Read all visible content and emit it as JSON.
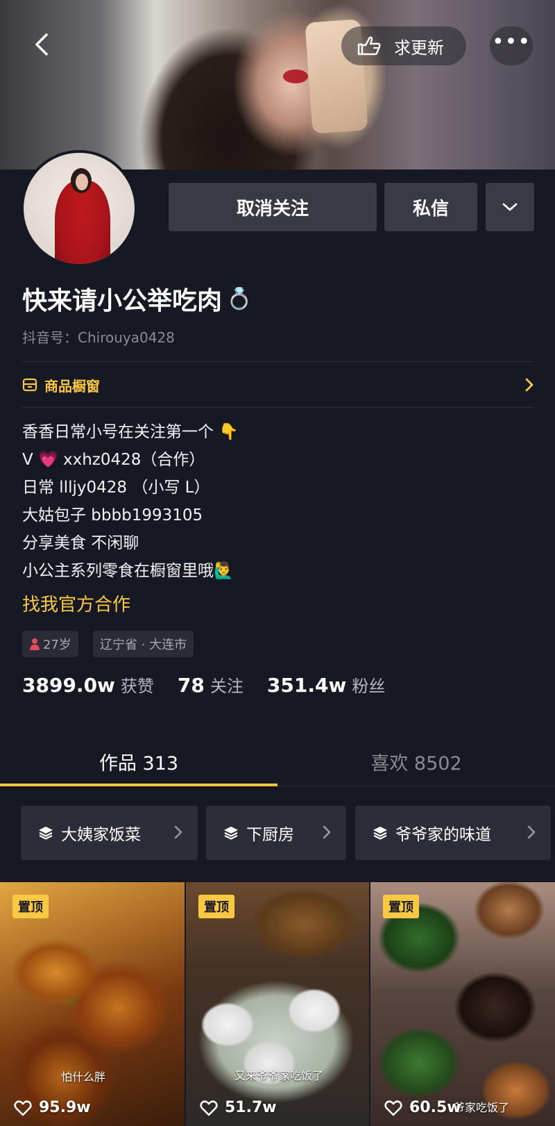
{
  "header": {
    "request_update_label": "求更新",
    "more_label": "•••"
  },
  "actions": {
    "unfollow_label": "取消关注",
    "message_label": "私信"
  },
  "profile": {
    "nickname": "快来请小公举吃肉",
    "nickname_emoji": "💍",
    "douyin_id": "抖音号：Chirouya0428",
    "shop_label": "商品橱窗",
    "bio": [
      "香香日常小号在关注第一个 👇",
      "V 💗 xxhz0428（合作）",
      "日常 llljy0428 （小写 L）",
      "大姑包子 bbbb1993105",
      "分享美食 不闲聊",
      "小公主系列零食在橱窗里哦🙋‍♂️"
    ],
    "cooperate_link": "找我官方合作",
    "tags": {
      "age": "27岁",
      "location": "辽宁省 · 大连市"
    },
    "stats": {
      "likes_num": "3899.0w",
      "likes_label": "获赞",
      "following_num": "78",
      "following_label": "关注",
      "followers_num": "351.4w",
      "followers_label": "粉丝"
    }
  },
  "tabs": {
    "works": "作品 313",
    "likes": "喜欢 8502"
  },
  "collections": [
    {
      "label": "大姨家饭菜"
    },
    {
      "label": "下厨房"
    },
    {
      "label": "爷爷家的味道"
    }
  ],
  "videos": [
    {
      "pinned": "置顶",
      "likes": "95.9w",
      "caption": "怕什么胖"
    },
    {
      "pinned": "置顶",
      "likes": "51.7w",
      "caption": "又来爷爷家吃饭了"
    },
    {
      "pinned": "置顶",
      "likes": "60.5w",
      "caption": "爷家吃饭了"
    }
  ],
  "colors": {
    "background": "#161823",
    "accent": "#fbc844",
    "button": "#3a3a44"
  }
}
